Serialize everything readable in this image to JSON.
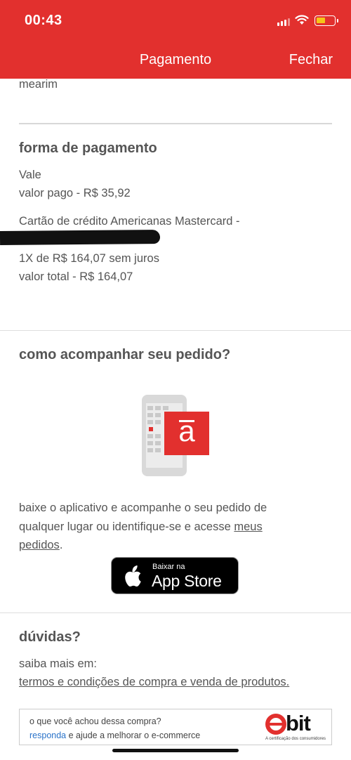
{
  "status_bar": {
    "time": "00:43"
  },
  "nav": {
    "title": "Pagamento",
    "close_label": "Fechar"
  },
  "address": {
    "tail_text": "mearim"
  },
  "payment": {
    "heading": "forma de pagamento",
    "voucher_label": "Vale",
    "voucher_paid": "valor pago - R$ 35,92",
    "card_label": "Cartão de crédito Americanas Mastercard -",
    "installments": "1X de R$ 164,07 sem juros",
    "total": "valor total - R$ 164,07"
  },
  "tracking": {
    "heading": "como acompanhar seu pedido?",
    "app_icon_letter": "a",
    "text_line1": "baixe o aplicativo e acompanhe o seu pedido de",
    "text_line2_pre": "qualquer lugar ou identifique-se e acesse ",
    "text_line2_link": "meus",
    "text_line3_link": "pedidos",
    "text_line3_post": ".",
    "app_store": {
      "small_label": "Baixar na",
      "big_label": "App Store",
      "icon": "apple-icon"
    }
  },
  "faq": {
    "heading": "dúvidas?",
    "intro": "saiba mais em:",
    "terms_link": "termos e condições de compra e venda de produtos."
  },
  "ebit": {
    "question": "o que você achou dessa compra?",
    "link": "responda",
    "rest": " e ajude a melhorar o e-commerce",
    "logo_word": "bit",
    "tagline": "A certificação dos consumidores"
  },
  "colors": {
    "brand_red": "#e2302e",
    "text_gray": "#555555",
    "link_blue": "#2a73c9"
  }
}
